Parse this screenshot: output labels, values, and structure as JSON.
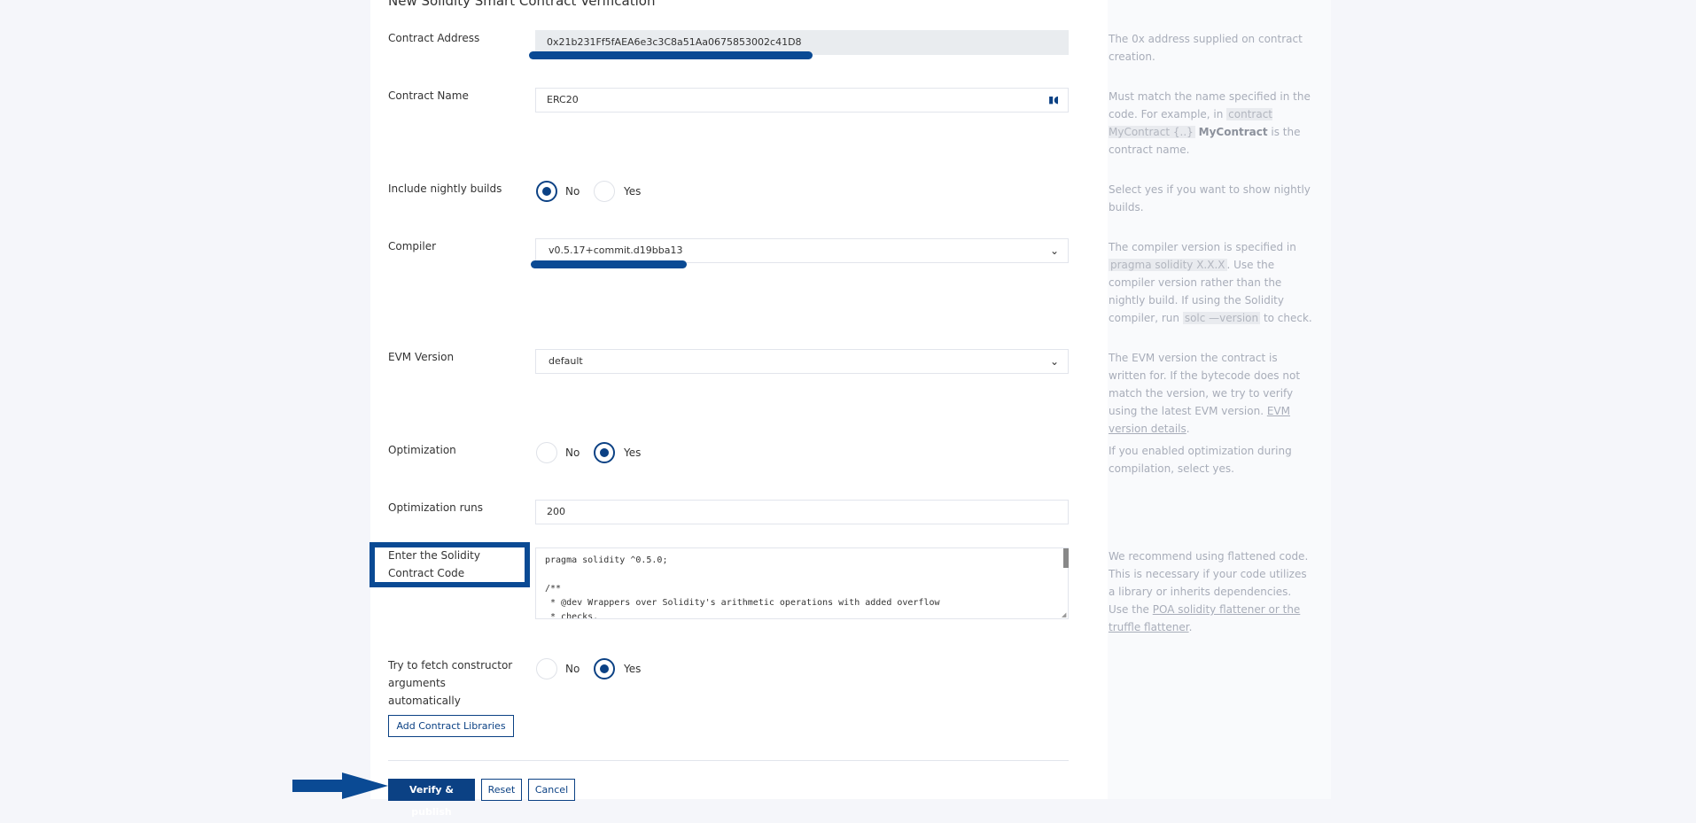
{
  "form": {
    "title": "New Solidity Smart Contract Verification",
    "contract_address": {
      "label": "Contract Address",
      "value": "0x21b231Ff5fAEA6e3c3C8a51Aa0675853002c41D8",
      "help": "The 0x address supplied on contract creation."
    },
    "contract_name": {
      "label": "Contract Name",
      "value": "ERC20",
      "help_pre": "Must match the name specified in the code. For example, in ",
      "help_code": "contract MyContract {..}",
      "help_bold": "MyContract",
      "help_post": " is the contract name."
    },
    "nightly": {
      "label": "Include nightly builds",
      "options": [
        "No",
        "Yes"
      ],
      "selected": "No",
      "help": "Select yes if you want to show nightly builds."
    },
    "compiler": {
      "label": "Compiler",
      "value": "v0.5.17+commit.d19bba13",
      "help_pre": "The compiler version is specified in ",
      "help_code1": "pragma solidity X.X.X",
      "help_mid": ". Use the compiler version rather than the nightly build. If using the Solidity compiler, run ",
      "help_code2": "solc —version",
      "help_post": " to check."
    },
    "evm_version": {
      "label": "EVM Version",
      "value": "default",
      "help_pre": "The EVM version the contract is written for. If the bytecode does not match the version, we try to verify using the latest EVM version. ",
      "help_link": "EVM version details",
      "help_post": "."
    },
    "optimization": {
      "label": "Optimization",
      "options": [
        "No",
        "Yes"
      ],
      "selected": "Yes",
      "help": "If you enabled optimization during compilation, select yes."
    },
    "optimization_runs": {
      "label": "Optimization runs",
      "value": "200"
    },
    "source_code": {
      "label": "Enter the Solidity Contract Code",
      "value": "pragma solidity ^0.5.0;\n\n/**\n * @dev Wrappers over Solidity's arithmetic operations with added overflow\n * checks.",
      "help_pre": "We recommend using flattened code. This is necessary if your code utilizes a library or inherits dependencies. Use the ",
      "help_link": "POA solidity flattener or the truffle flattener",
      "help_post": "."
    },
    "constructor_args": {
      "label": "Try to fetch constructor arguments automatically",
      "options": [
        "No",
        "Yes"
      ],
      "selected": "Yes"
    },
    "buttons": {
      "add_libraries": "Add Contract Libraries",
      "verify": "Verify & publish",
      "reset": "Reset",
      "cancel": "Cancel"
    }
  },
  "colors": {
    "primary": "#0b4184",
    "annotation": "#0a4a94",
    "help_text": "#a8adb9"
  },
  "icons": {
    "select_caret": "chevron-down-icon",
    "field_extension": "password-manager-icon",
    "annotation_arrow": "arrow-right-icon"
  }
}
